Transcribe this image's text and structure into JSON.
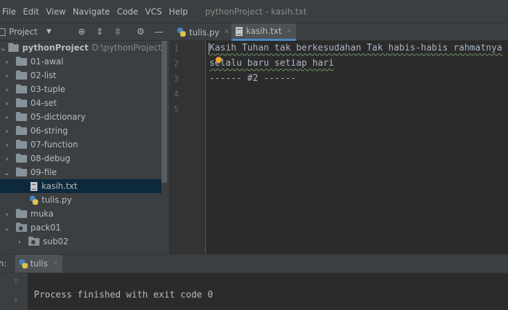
{
  "menu": [
    "File",
    "Edit",
    "View",
    "Navigate",
    "Code",
    "VCS",
    "Help"
  ],
  "window_title": "pythonProject - kasih.txt",
  "project_panel": {
    "title": "Project",
    "root": {
      "name": "pythonProject",
      "path": "D:\\pythonProject"
    },
    "items": [
      {
        "label": "01-awal",
        "type": "folder"
      },
      {
        "label": "02-list",
        "type": "folder"
      },
      {
        "label": "03-tuple",
        "type": "folder"
      },
      {
        "label": "04-set",
        "type": "folder"
      },
      {
        "label": "05-dictionary",
        "type": "folder"
      },
      {
        "label": "06-string",
        "type": "folder"
      },
      {
        "label": "07-function",
        "type": "folder"
      },
      {
        "label": "08-debug",
        "type": "folder"
      },
      {
        "label": "09-file",
        "type": "folder",
        "expanded": true
      },
      {
        "label": "kasih.txt",
        "type": "text-file",
        "selected": true
      },
      {
        "label": "tulis.py",
        "type": "python-file"
      },
      {
        "label": "muka",
        "type": "folder"
      },
      {
        "label": "pack01",
        "type": "package",
        "expanded": true
      },
      {
        "label": "sub02",
        "type": "package"
      }
    ]
  },
  "editor_tabs": [
    {
      "label": "tulis.py",
      "icon": "python-file-icon",
      "active": false
    },
    {
      "label": "kasih.txt",
      "icon": "text-file-icon",
      "active": true
    }
  ],
  "line_numbers": [
    "1",
    "2",
    "3",
    "4",
    "5"
  ],
  "code_lines": [
    "Kasih Tuhan tak berkesudahan Tak habis-habis rahmatnya",
    "selalu baru setiap hari",
    "------ #2 ------"
  ],
  "run_panel": {
    "prefix": "n:",
    "tab_label": "tulis",
    "output": "Process finished with exit code 0"
  },
  "colors": {
    "panel_bg": "#3c3f41",
    "editor_bg": "#2b2b2b",
    "selection": "#0d293e",
    "active_tab_underline": "#4a88c7",
    "spellcheck_underline": "#5d7d57"
  }
}
